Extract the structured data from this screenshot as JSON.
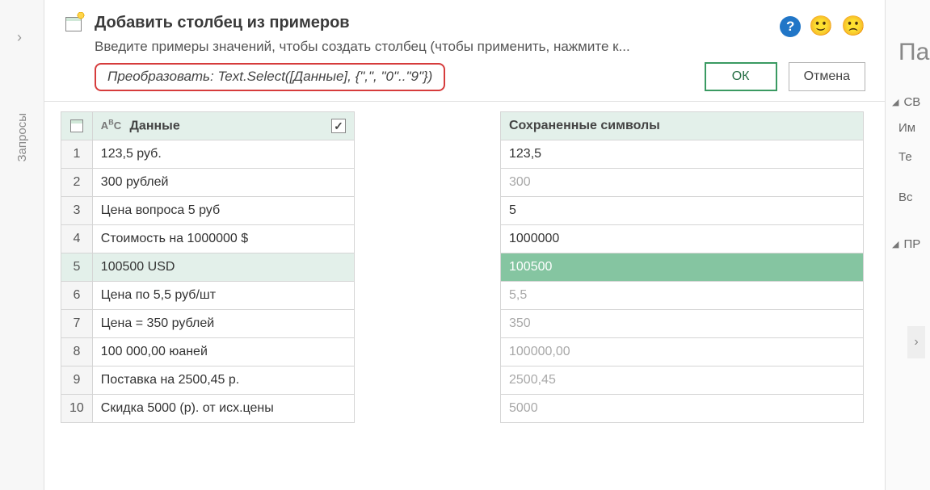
{
  "left_panel": {
    "label": "Запросы"
  },
  "banner": {
    "title": "Добавить столбец из примеров",
    "subtitle": "Введите примеры значений, чтобы создать столбец (чтобы применить, нажмите к...",
    "formula_prefix": "Преобразовать: ",
    "formula_body": "Text.Select([Данные], {\",\", \"0\"..\"9\"})",
    "ok_label": "ОК",
    "cancel_label": "Отмена"
  },
  "icons": {
    "help": "?",
    "smile": "🙂",
    "frown": "🙁",
    "check": "✓",
    "chev_right": "›",
    "tri": "◢"
  },
  "source_table": {
    "header": "Данные",
    "type_prefix": "A",
    "type_suffix": "C",
    "rows": [
      {
        "n": "1",
        "v": "123,5 руб."
      },
      {
        "n": "2",
        "v": "300 рублей"
      },
      {
        "n": "3",
        "v": "Цена вопроса 5 руб"
      },
      {
        "n": "4",
        "v": "Стоимость на 1000000 $"
      },
      {
        "n": "5",
        "v": "100500 USD"
      },
      {
        "n": "6",
        "v": "Цена по 5,5 руб/шт"
      },
      {
        "n": "7",
        "v": "Цена = 350 рублей"
      },
      {
        "n": "8",
        "v": "100 000,00 юаней"
      },
      {
        "n": "9",
        "v": "Поставка на 2500,45 р."
      },
      {
        "n": "10",
        "v": "Скидка 5000 (р). от исх.цены"
      }
    ],
    "selected_index": 4
  },
  "output_table": {
    "header": "Сохраненные символы",
    "rows": [
      {
        "v": "123,5",
        "placeholder": false
      },
      {
        "v": "300",
        "placeholder": true
      },
      {
        "v": "5",
        "placeholder": false
      },
      {
        "v": "1000000",
        "placeholder": false
      },
      {
        "v": "100500",
        "placeholder": true
      },
      {
        "v": "5,5",
        "placeholder": true
      },
      {
        "v": "350",
        "placeholder": true
      },
      {
        "v": "100000,00",
        "placeholder": true
      },
      {
        "v": "2500,45",
        "placeholder": true
      },
      {
        "v": "5000",
        "placeholder": true
      }
    ]
  },
  "right_panel": {
    "title": "Па",
    "section1": "СВ",
    "row1": "Им",
    "row2": "Те",
    "row3": "Вс",
    "section2": "ПР"
  }
}
